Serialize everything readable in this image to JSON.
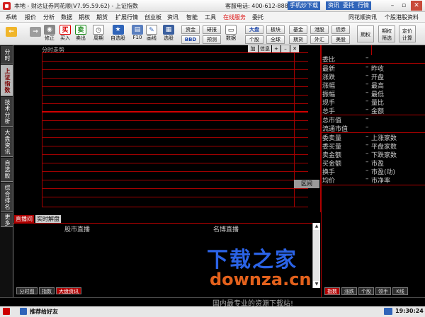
{
  "titlebar": {
    "title": "本地 - 财达证券同花顺(V7.95.59.62) - 上证指数",
    "hotline": "客服电话: 400-612-8888",
    "links": [
      "手机炒下载",
      "资讯",
      "委托",
      "行情"
    ],
    "win_buttons": [
      "–",
      "▫",
      "✕"
    ]
  },
  "menu": {
    "items": [
      "系统",
      "报价",
      "分析",
      "数据",
      "期权",
      "期货",
      "扩展行情",
      "创业板",
      "资讯",
      "智能",
      "工具",
      "在线服务",
      "委托"
    ],
    "right_items": [
      "同花顺资讯",
      "个股港股资料"
    ]
  },
  "toolbar": {
    "tools": [
      {
        "label": "",
        "icon": "←"
      },
      {
        "label": "",
        "icon": "→"
      },
      {
        "label": "修正",
        "icon": "◉"
      },
      {
        "label": "买入",
        "icon": "买"
      },
      {
        "label": "卖出",
        "icon": "卖"
      },
      {
        "label": "周期",
        "icon": "◷"
      },
      {
        "label": "自选股",
        "icon": "★"
      },
      {
        "label": "F10",
        "icon": "▤"
      },
      {
        "label": "画线",
        "icon": "✎"
      },
      {
        "label": "选股",
        "icon": "▦"
      }
    ],
    "buttons_row1": [
      "资金",
      "研报",
      "",
      "大盘",
      "板块",
      "基金",
      "港股",
      "债券"
    ],
    "buttons_row2": [
      "BBD",
      "预测",
      "",
      "个股",
      "全球",
      "期货",
      "外汇",
      "美股"
    ],
    "data_label": "数据",
    "big_buttons": [
      "期权",
      "期权\n筛选",
      "定价\n计算"
    ]
  },
  "left_tabs": [
    "分时走势",
    "上证指数",
    "技术分析",
    "大盘资讯",
    "自选股",
    "综合排名",
    "更多"
  ],
  "chart": {
    "title": "分时走势",
    "controls": [
      "加",
      "信息",
      "+",
      "–",
      "✕"
    ],
    "interval_label": "区间"
  },
  "quote": {
    "top_labels": [
      "委比",
      "最新",
      "涨跌",
      "涨幅",
      "振幅",
      "现手",
      "总手"
    ],
    "top_right_labels": [
      "",
      "昨收",
      "开盘",
      "最高",
      "最低",
      "量比",
      "金额"
    ],
    "mid_labels": [
      "总市值",
      "流通市值"
    ],
    "bottom_labels": [
      "委卖量",
      "委买量",
      "卖金额",
      "买金额",
      "换手",
      "均价"
    ],
    "bottom_right_labels": [
      "上涨家数",
      "平盘家数",
      "下跌家数",
      "市盈",
      "市盈(动)",
      "市净率"
    ],
    "right_tabs": [
      "指数",
      "涨跌",
      "个股",
      "领手",
      "K线"
    ]
  },
  "news": {
    "tabs": [
      "直播间",
      "实时解盘"
    ],
    "col1": "股市直播",
    "col2": "名博直播"
  },
  "bottom_tabs": [
    "分时图",
    "指数",
    "大盘资讯"
  ],
  "status": {
    "recommend": "推荐给好友",
    "clock": "19:30:24"
  },
  "watermark": {
    "logo": "下载之家",
    "domain": "downza.cn",
    "slogan": "国内最专业的资源下载站!"
  },
  "colors": {
    "grid": "#a50000",
    "watermark_blue": "#2b63e6",
    "watermark_orange": "#e3611c"
  }
}
